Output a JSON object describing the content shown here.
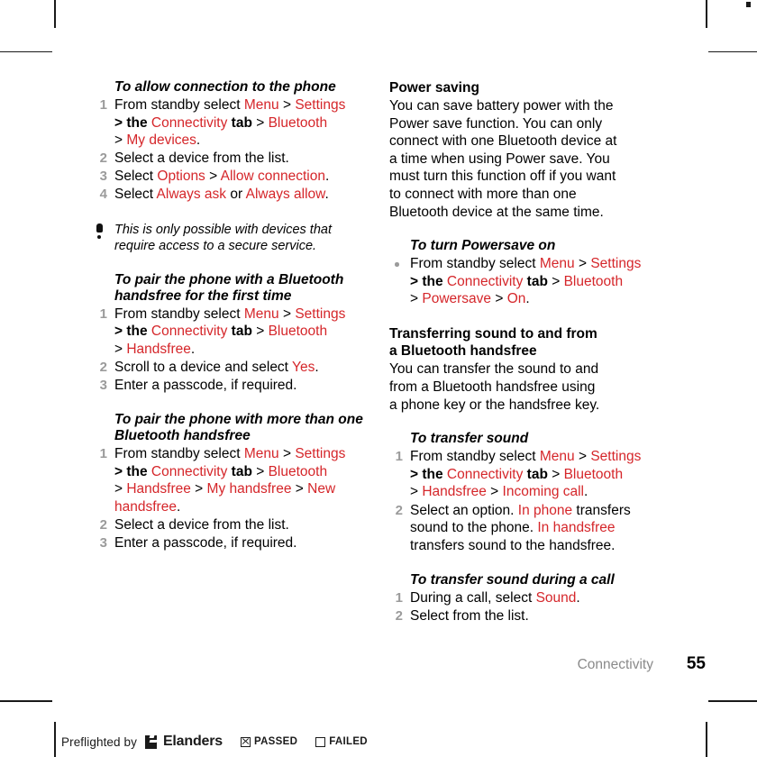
{
  "document": {
    "chapter": "Connectivity",
    "page_number": "55"
  },
  "left_column": {
    "task1": {
      "heading": "To allow connection to the phone",
      "steps": [
        {
          "marker": "1",
          "lines": [
            {
              "parts": [
                {
                  "t": "From standby select ",
                  "s": "plain"
                },
                {
                  "t": "Menu",
                  "s": "ui"
                },
                {
                  "t": " > ",
                  "s": "plain"
                },
                {
                  "t": "Settings",
                  "s": "ui"
                }
              ]
            },
            {
              "parts": [
                {
                  "t": "> the ",
                  "s": "bold"
                },
                {
                  "t": "Connectivity",
                  "s": "ui"
                },
                {
                  "t": " tab",
                  "s": "bold"
                },
                {
                  "t": " > ",
                  "s": "plain"
                },
                {
                  "t": "Bluetooth",
                  "s": "ui"
                }
              ]
            },
            {
              "parts": [
                {
                  "t": "> ",
                  "s": "plain"
                },
                {
                  "t": "My devices",
                  "s": "ui"
                },
                {
                  "t": ".",
                  "s": "plain"
                }
              ]
            }
          ]
        },
        {
          "marker": "2",
          "lines": [
            {
              "parts": [
                {
                  "t": "Select a device from the list.",
                  "s": "plain"
                }
              ]
            }
          ]
        },
        {
          "marker": "3",
          "lines": [
            {
              "parts": [
                {
                  "t": "Select ",
                  "s": "plain"
                },
                {
                  "t": "Options",
                  "s": "ui"
                },
                {
                  "t": " > ",
                  "s": "plain"
                },
                {
                  "t": "Allow connection",
                  "s": "ui"
                },
                {
                  "t": ".",
                  "s": "plain"
                }
              ]
            }
          ]
        },
        {
          "marker": "4",
          "lines": [
            {
              "parts": [
                {
                  "t": "Select ",
                  "s": "plain"
                },
                {
                  "t": "Always ask",
                  "s": "ui"
                },
                {
                  "t": " or ",
                  "s": "plain"
                },
                {
                  "t": "Always allow",
                  "s": "ui"
                },
                {
                  "t": ".",
                  "s": "plain"
                }
              ]
            }
          ]
        }
      ]
    },
    "note": {
      "icon": "exclamation-icon",
      "lines": [
        "This is only possible with devices that",
        "require access to a secure service."
      ]
    },
    "task2": {
      "heading_lines": [
        "To pair the phone with a Bluetooth",
        "handsfree for the first time"
      ],
      "steps": [
        {
          "marker": "1",
          "lines": [
            {
              "parts": [
                {
                  "t": "From standby select ",
                  "s": "plain"
                },
                {
                  "t": "Menu",
                  "s": "ui"
                },
                {
                  "t": " > ",
                  "s": "plain"
                },
                {
                  "t": "Settings",
                  "s": "ui"
                }
              ]
            },
            {
              "parts": [
                {
                  "t": "> the ",
                  "s": "bold"
                },
                {
                  "t": "Connectivity",
                  "s": "ui"
                },
                {
                  "t": " tab",
                  "s": "bold"
                },
                {
                  "t": " > ",
                  "s": "plain"
                },
                {
                  "t": "Bluetooth",
                  "s": "ui"
                }
              ]
            },
            {
              "parts": [
                {
                  "t": "> ",
                  "s": "plain"
                },
                {
                  "t": "Handsfree",
                  "s": "ui"
                },
                {
                  "t": ".",
                  "s": "plain"
                }
              ]
            }
          ]
        },
        {
          "marker": "2",
          "lines": [
            {
              "parts": [
                {
                  "t": "Scroll to a device and select ",
                  "s": "plain"
                },
                {
                  "t": "Yes",
                  "s": "ui"
                },
                {
                  "t": ".",
                  "s": "plain"
                }
              ]
            }
          ]
        },
        {
          "marker": "3",
          "lines": [
            {
              "parts": [
                {
                  "t": "Enter a passcode, if required.",
                  "s": "plain"
                }
              ]
            }
          ]
        }
      ]
    },
    "task3": {
      "heading_lines": [
        "To pair the phone with more than one",
        "Bluetooth handsfree"
      ],
      "steps": [
        {
          "marker": "1",
          "lines": [
            {
              "parts": [
                {
                  "t": "From standby select ",
                  "s": "plain"
                },
                {
                  "t": "Menu",
                  "s": "ui"
                },
                {
                  "t": " > ",
                  "s": "plain"
                },
                {
                  "t": "Settings",
                  "s": "ui"
                }
              ]
            },
            {
              "parts": [
                {
                  "t": "> the ",
                  "s": "bold"
                },
                {
                  "t": "Connectivity",
                  "s": "ui"
                },
                {
                  "t": " tab",
                  "s": "bold"
                },
                {
                  "t": " > ",
                  "s": "plain"
                },
                {
                  "t": "Bluetooth",
                  "s": "ui"
                }
              ]
            },
            {
              "parts": [
                {
                  "t": "> ",
                  "s": "plain"
                },
                {
                  "t": "Handsfree",
                  "s": "ui"
                },
                {
                  "t": " > ",
                  "s": "plain"
                },
                {
                  "t": "My handsfree",
                  "s": "ui"
                },
                {
                  "t": " > ",
                  "s": "plain"
                },
                {
                  "t": "New",
                  "s": "ui"
                }
              ]
            },
            {
              "parts": [
                {
                  "t": "handsfree",
                  "s": "ui"
                },
                {
                  "t": ".",
                  "s": "plain"
                }
              ]
            }
          ]
        },
        {
          "marker": "2",
          "lines": [
            {
              "parts": [
                {
                  "t": "Select a device from the list.",
                  "s": "plain"
                }
              ]
            }
          ]
        },
        {
          "marker": "3",
          "lines": [
            {
              "parts": [
                {
                  "t": "Enter a passcode, if required.",
                  "s": "plain"
                }
              ]
            }
          ]
        }
      ]
    }
  },
  "right_column": {
    "section1": {
      "heading": "Power saving",
      "body_lines": [
        "You can save battery power with the",
        "Power save function. You can only",
        "connect with one Bluetooth device at",
        "a time when using Power save. You",
        "must turn this function off if you want",
        "to connect with more than one",
        "Bluetooth device at the same time."
      ]
    },
    "task1": {
      "heading": "To turn Powersave on",
      "steps": [
        {
          "marker": "bullet",
          "lines": [
            {
              "parts": [
                {
                  "t": "From standby select ",
                  "s": "plain"
                },
                {
                  "t": "Menu",
                  "s": "ui"
                },
                {
                  "t": " > ",
                  "s": "plain"
                },
                {
                  "t": "Settings",
                  "s": "ui"
                }
              ]
            },
            {
              "parts": [
                {
                  "t": "> the ",
                  "s": "bold"
                },
                {
                  "t": "Connectivity",
                  "s": "ui"
                },
                {
                  "t": " tab",
                  "s": "bold"
                },
                {
                  "t": " > ",
                  "s": "plain"
                },
                {
                  "t": "Bluetooth",
                  "s": "ui"
                }
              ]
            },
            {
              "parts": [
                {
                  "t": "> ",
                  "s": "plain"
                },
                {
                  "t": "Powersave",
                  "s": "ui"
                },
                {
                  "t": " > ",
                  "s": "plain"
                },
                {
                  "t": "On",
                  "s": "ui"
                },
                {
                  "t": ".",
                  "s": "plain"
                }
              ]
            }
          ]
        }
      ]
    },
    "section2": {
      "heading_lines": [
        "Transferring sound to and from",
        "a Bluetooth handsfree"
      ],
      "body_lines": [
        "You can transfer the sound to and",
        "from a Bluetooth handsfree using",
        "a phone key or the handsfree key."
      ]
    },
    "task2": {
      "heading": "To transfer sound",
      "steps": [
        {
          "marker": "1",
          "lines": [
            {
              "parts": [
                {
                  "t": "From standby select ",
                  "s": "plain"
                },
                {
                  "t": "Menu",
                  "s": "ui"
                },
                {
                  "t": " > ",
                  "s": "plain"
                },
                {
                  "t": "Settings",
                  "s": "ui"
                }
              ]
            },
            {
              "parts": [
                {
                  "t": "> the ",
                  "s": "bold"
                },
                {
                  "t": "Connectivity",
                  "s": "ui"
                },
                {
                  "t": " tab",
                  "s": "bold"
                },
                {
                  "t": " > ",
                  "s": "plain"
                },
                {
                  "t": "Bluetooth",
                  "s": "ui"
                }
              ]
            },
            {
              "parts": [
                {
                  "t": "> ",
                  "s": "plain"
                },
                {
                  "t": "Handsfree",
                  "s": "ui"
                },
                {
                  "t": " > ",
                  "s": "plain"
                },
                {
                  "t": "Incoming call",
                  "s": "ui"
                },
                {
                  "t": ".",
                  "s": "plain"
                }
              ]
            }
          ]
        },
        {
          "marker": "2",
          "lines": [
            {
              "parts": [
                {
                  "t": "Select an option. ",
                  "s": "plain"
                },
                {
                  "t": "In phone",
                  "s": "ui"
                },
                {
                  "t": " transfers",
                  "s": "plain"
                }
              ]
            },
            {
              "parts": [
                {
                  "t": "sound to the phone. ",
                  "s": "plain"
                },
                {
                  "t": "In handsfree",
                  "s": "ui"
                }
              ]
            },
            {
              "parts": [
                {
                  "t": "transfers sound to the handsfree.",
                  "s": "plain"
                }
              ]
            }
          ]
        }
      ]
    },
    "task3": {
      "heading": "To transfer sound during a call",
      "steps": [
        {
          "marker": "1",
          "lines": [
            {
              "parts": [
                {
                  "t": "During a call, select ",
                  "s": "plain"
                },
                {
                  "t": "Sound",
                  "s": "ui"
                },
                {
                  "t": ".",
                  "s": "plain"
                }
              ]
            }
          ]
        },
        {
          "marker": "2",
          "lines": [
            {
              "parts": [
                {
                  "t": "Select from the list.",
                  "s": "plain"
                }
              ]
            }
          ]
        }
      ]
    }
  },
  "preflight": {
    "prefix": "Preflighted by",
    "brand": "Elanders",
    "passed_label": "PASSED",
    "failed_label": "FAILED",
    "passed_checked": true,
    "failed_checked": false
  },
  "colors": {
    "ui_red": "#d5262a",
    "marker_gray": "#9b9b9b",
    "chapter_gray": "#8a8a8a"
  }
}
